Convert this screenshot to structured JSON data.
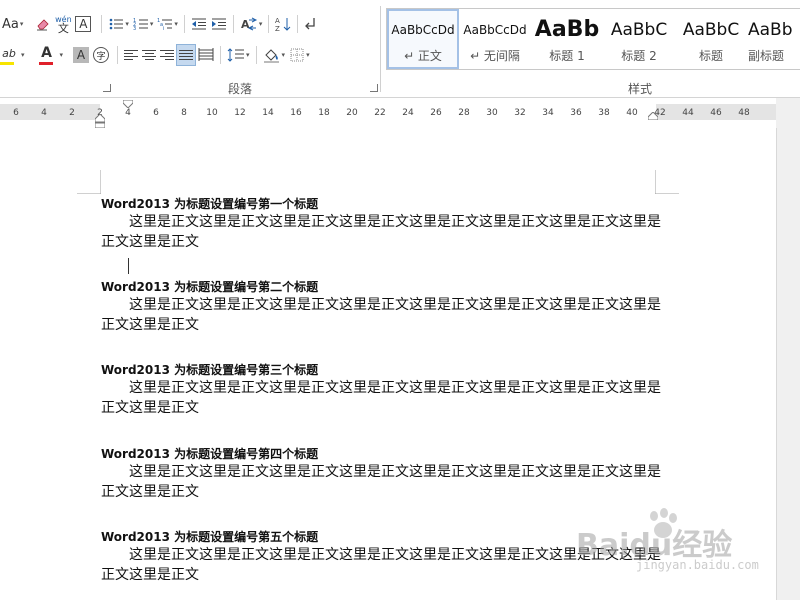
{
  "ribbon": {
    "font_row1": {
      "font_size_glyph": "Aa",
      "phonetic_top": "wén",
      "phonetic_bottom": "文",
      "border_char": "A"
    },
    "font_row2": {
      "highlight_glyph": "ab",
      "font_color_glyph": "A",
      "shading_char": "A",
      "enclose_char": "字"
    },
    "paragraph_label": "段落",
    "styles_label": "样式",
    "styles": [
      {
        "sample": "AaBbCcDd",
        "name": "↵ 正文"
      },
      {
        "sample": "AaBbCcDd",
        "name": "↵ 无间隔"
      },
      {
        "sample": "AaBb",
        "name": "标题 1"
      },
      {
        "sample": "AaBbC",
        "name": "标题 2"
      },
      {
        "sample": "AaBbC",
        "name": "标题"
      },
      {
        "sample": "AaBb",
        "name": "副标题"
      }
    ],
    "colors": {
      "font_color": "#e0202a",
      "highlight_color": "#f7e400",
      "active_style_border": "#a4c1e6"
    }
  },
  "ruler": {
    "ticks": [
      "6",
      "4",
      "2",
      "2",
      "4",
      "6",
      "8",
      "10",
      "12",
      "14",
      "16",
      "18",
      "20",
      "22",
      "24",
      "26",
      "28",
      "30",
      "32",
      "34",
      "36",
      "38",
      "40",
      "42",
      "44",
      "46",
      "48"
    ]
  },
  "document": {
    "sections": [
      {
        "heading": "Word2013 为标题设置编号第一个标题",
        "body": "这里是正文这里是正文这里是正文这里是正文这里是正文这里是正文这里是正文这里是正文这里是正文"
      },
      {
        "heading": "Word2013 为标题设置编号第二个标题",
        "body": "这里是正文这里是正文这里是正文这里是正文这里是正文这里是正文这里是正文这里是正文这里是正文"
      },
      {
        "heading": "Word2013 为标题设置编号第三个标题",
        "body": "这里是正文这里是正文这里是正文这里是正文这里是正文这里是正文这里是正文这里是正文这里是正文"
      },
      {
        "heading": "Word2013 为标题设置编号第四个标题",
        "body": "这里是正文这里是正文这里是正文这里是正文这里是正文这里是正文这里是正文这里是正文这里是正文"
      },
      {
        "heading": "Word2013 为标题设置编号第五个标题",
        "body": "这里是正文这里是正文这里是正文这里是正文这里是正文这里是正文这里是正文这里是正文这里是正文"
      }
    ]
  },
  "watermark": {
    "main": "Baidu经验",
    "sub": "jingyan.baidu.com"
  }
}
